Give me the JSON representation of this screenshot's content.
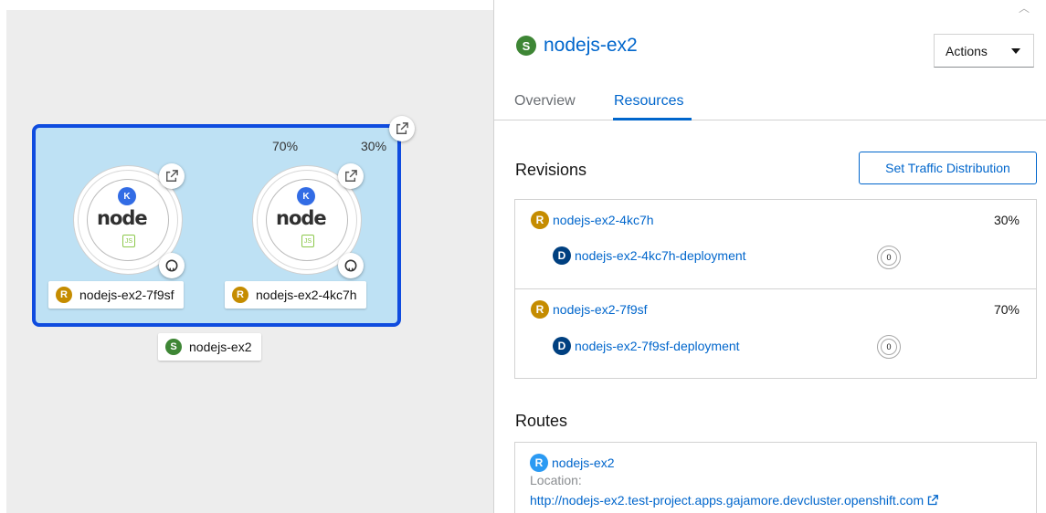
{
  "topology": {
    "group_label": "nodejs-ex2",
    "group_badge": "S",
    "traffic_left_pct": "70%",
    "traffic_right_pct": "30%",
    "nodes": [
      {
        "label": "nodejs-ex2-7f9sf",
        "badge": "R",
        "logo_text": "node",
        "k_badge": "K",
        "js_text": "JS"
      },
      {
        "label": "nodejs-ex2-4kc7h",
        "badge": "R",
        "logo_text": "node",
        "k_badge": "K",
        "js_text": "JS"
      }
    ]
  },
  "panel": {
    "title": "nodejs-ex2",
    "title_badge": "S",
    "actions_label": "Actions",
    "tabs": [
      {
        "label": "Overview",
        "active": false
      },
      {
        "label": "Resources",
        "active": true
      }
    ],
    "revisions": {
      "heading": "Revisions",
      "traffic_button": "Set Traffic Distribution",
      "items": [
        {
          "badge": "R",
          "name": "nodejs-ex2-4kc7h",
          "percent": "30%",
          "deployment_badge": "D",
          "deployment": "nodejs-ex2-4kc7h-deployment",
          "pods": "0"
        },
        {
          "badge": "R",
          "name": "nodejs-ex2-7f9sf",
          "percent": "70%",
          "deployment_badge": "D",
          "deployment": "nodejs-ex2-7f9sf-deployment",
          "pods": "0"
        }
      ]
    },
    "routes": {
      "heading": "Routes",
      "items": [
        {
          "badge": "R",
          "name": "nodejs-ex2",
          "location_label": "Location:",
          "url": "http://nodejs-ex2.test-project.apps.gajamore.devcluster.openshift.com"
        }
      ]
    }
  },
  "colors": {
    "group_fill": "#bee1f4",
    "group_border": "#0f4cdf",
    "link": "#0066cc",
    "revision_badge": "#c58c00",
    "service_badge": "#3e8635",
    "deployment_badge": "#004080",
    "route_badge": "#2b9af3"
  }
}
